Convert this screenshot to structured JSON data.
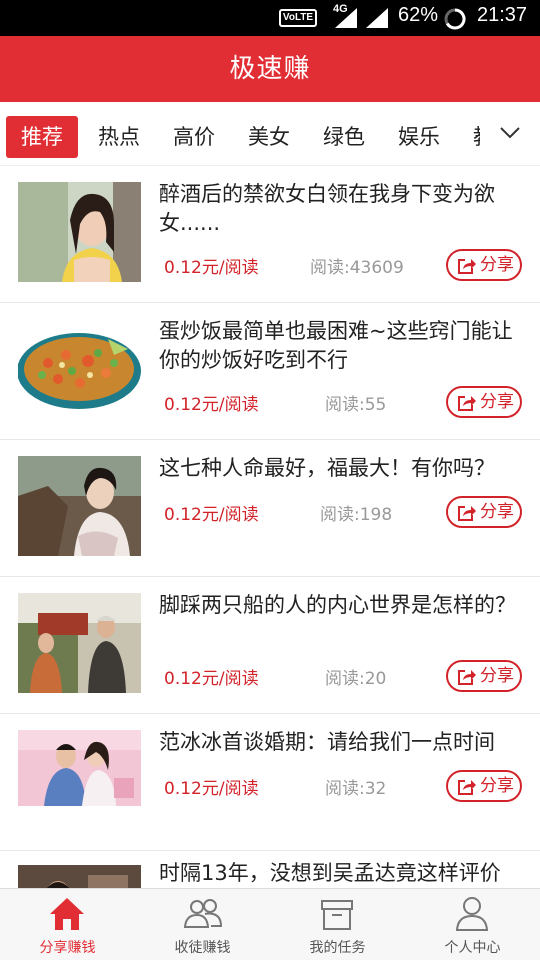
{
  "status_bar": {
    "volte": "VoLTE",
    "network": "4G",
    "battery": "62%",
    "time": "21:37"
  },
  "header": {
    "title": "极速赚",
    "color": "#e12d34"
  },
  "tabs": [
    {
      "label": "推荐",
      "active": true
    },
    {
      "label": "热点",
      "active": false
    },
    {
      "label": "高价",
      "active": false
    },
    {
      "label": "美女",
      "active": false
    },
    {
      "label": "绿色",
      "active": false
    },
    {
      "label": "娱乐",
      "active": false
    },
    {
      "label": "教",
      "active": false
    }
  ],
  "news": [
    {
      "title": "醉酒后的禁欲女白领在我身下变为欲女......",
      "price": "0.12元/阅读",
      "reads": "阅读:43609",
      "share": "分享"
    },
    {
      "title": "蛋炒饭最简单也最困难~这些窍门能让你的炒饭好吃到不行",
      "price": "0.12元/阅读",
      "reads": "阅读:55",
      "share": "分享"
    },
    {
      "title": "这七种人命最好，福最大！有你吗？",
      "price": "0.12元/阅读",
      "reads": "阅读:198",
      "share": "分享"
    },
    {
      "title": "脚踩两只船的人的内心世界是怎样的？",
      "price": "0.12元/阅读",
      "reads": "阅读:20",
      "share": "分享"
    },
    {
      "title": "范冰冰首谈婚期：请给我们一点时间",
      "price": "0.12元/阅读",
      "reads": "阅读:32",
      "share": "分享"
    },
    {
      "title": "时隔13年，没想到吴孟达竟这样评价",
      "price": "",
      "reads": "",
      "share": ""
    }
  ],
  "bottom_nav": [
    {
      "label": "分享赚钱",
      "icon": "home-icon",
      "active": true
    },
    {
      "label": "收徒赚钱",
      "icon": "people-icon",
      "active": false
    },
    {
      "label": "我的任务",
      "icon": "task-box-icon",
      "active": false
    },
    {
      "label": "个人中心",
      "icon": "person-icon",
      "active": false
    }
  ]
}
